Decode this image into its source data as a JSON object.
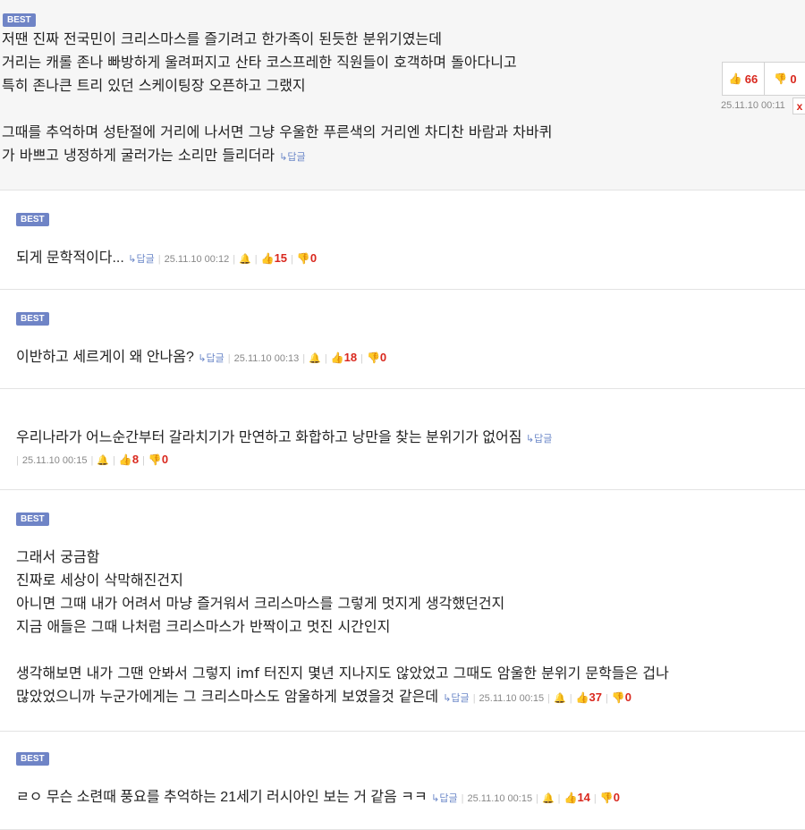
{
  "badge": "BEST",
  "reply_label": "↳답글",
  "comments": [
    {
      "best": true,
      "lines": [
        "저땐 진짜 전국민이 크리스마스를 즐기려고 한가족이 된듯한 분위기였는데",
        "거리는 캐롤 존나 빠방하게 울려퍼지고 산타 코스프레한 직원들이 호객하며 돌아다니고",
        "특히 존나큰 트리 있던 스케이팅장 오픈하고 그랬지",
        "",
        "그때를 추억하며 성탄절에 거리에 나서면 그냥 우울한 푸른색의 거리엔 차디찬 바람과 차바퀴",
        "가 바쁘고 냉정하게 굴러가는 소리만 들리더라"
      ],
      "date": "25.11.10 00:11",
      "up": "66",
      "down": "0",
      "delete": "x"
    },
    {
      "best": true,
      "lines": [
        "되게 문학적이다..."
      ],
      "date": "25.11.10 00:12",
      "up": "15",
      "down": "0"
    },
    {
      "best": true,
      "lines": [
        "이반하고 세르게이 왜 안나옴?"
      ],
      "date": "25.11.10 00:13",
      "up": "18",
      "down": "0"
    },
    {
      "best": false,
      "lines": [
        "우리나라가 어느순간부터 갈라치기가 만연하고 화합하고 낭만을 찾는 분위기가 없어짐"
      ],
      "date": "25.11.10 00:15",
      "up": "8",
      "down": "0"
    },
    {
      "best": true,
      "lines": [
        "그래서 궁금함",
        "진짜로 세상이 삭막해진건지",
        "아니면 그때 내가 어려서 마냥 즐거워서 크리스마스를 그렇게 멋지게 생각했던건지",
        "지금 애들은 그때 나처럼 크리스마스가 반짝이고 멋진 시간인지",
        "",
        "생각해보면 내가 그땐 안봐서 그렇지 imf 터진지 몇년 지나지도 않았었고 그때도 암울한 분위기 문학들은 겁나",
        "많았었으니까 누군가에게는 그 크리스마스도 암울하게 보였을것 같은데"
      ],
      "date": "25.11.10 00:15",
      "up": "37",
      "down": "0"
    },
    {
      "best": true,
      "lines": [
        "ㄹㅇ 무슨 소련때 풍요를 추억하는 21세기 러시아인 보는 거 같음 ㅋㅋ"
      ],
      "date": "25.11.10 00:15",
      "up": "14",
      "down": "0"
    }
  ],
  "colors": {
    "badge_bg": "#6f84c6",
    "count_red": "#d9281e",
    "icon_blue": "#3f62c6",
    "first_comment_bg": "#f6f6f6"
  },
  "icons": {
    "thumb_up": "thumbs-up-icon",
    "thumb_down": "thumbs-down-icon",
    "bell": "bell-icon",
    "reply": "reply-arrow-icon"
  }
}
